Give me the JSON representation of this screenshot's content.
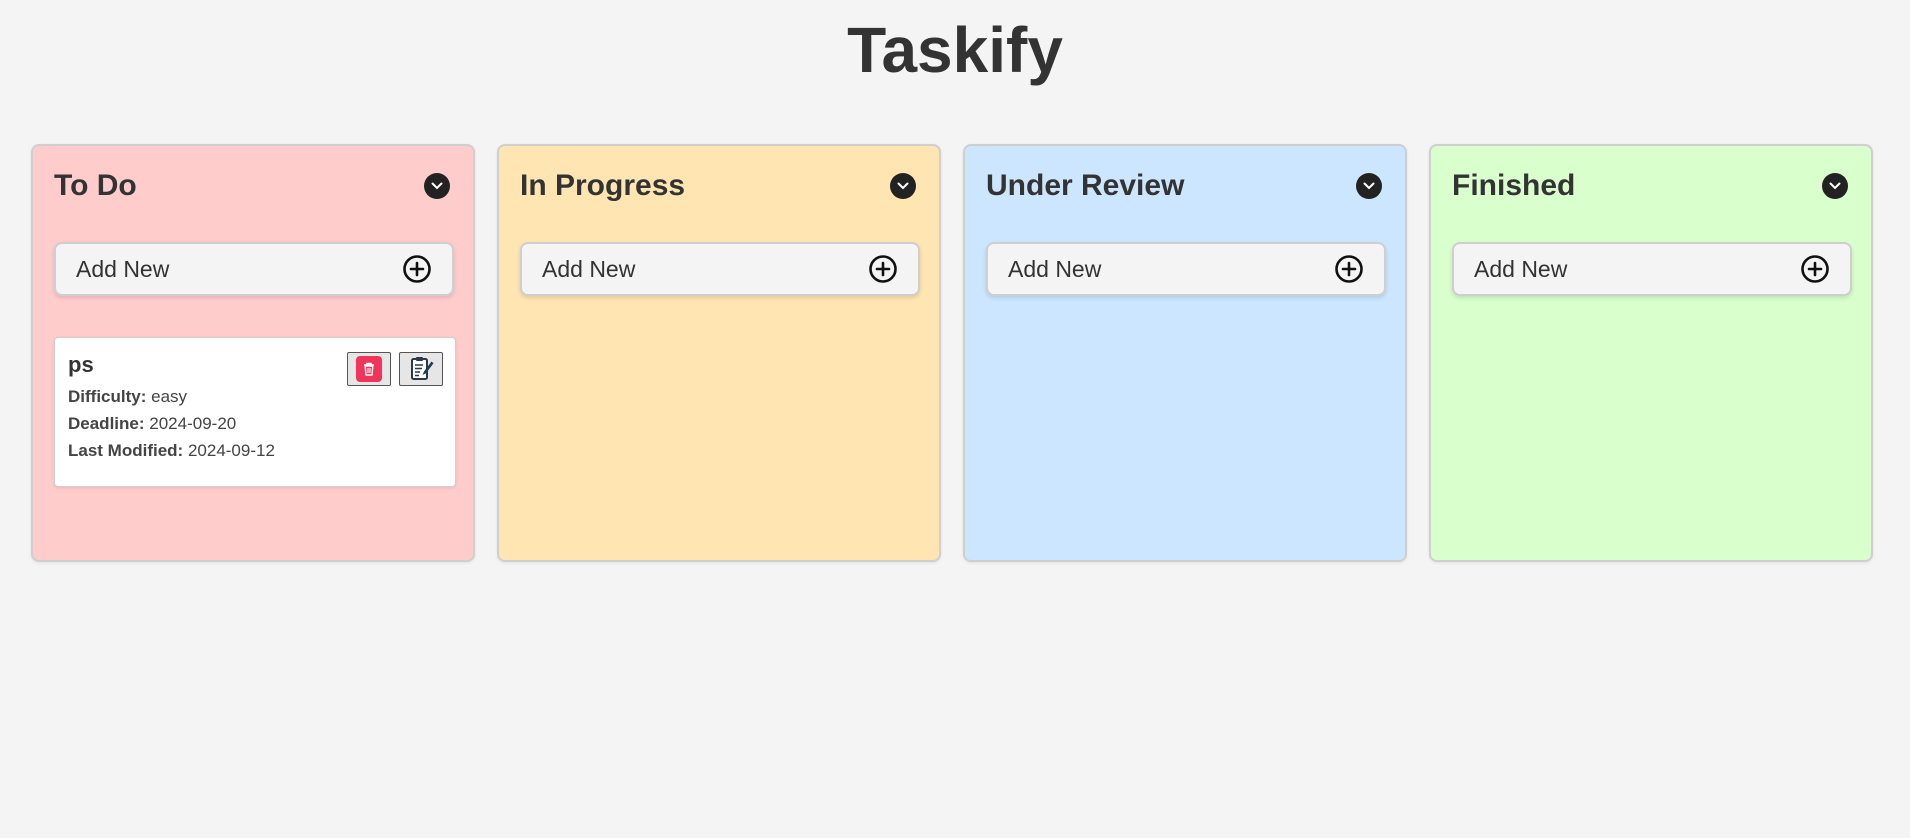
{
  "app": {
    "title": "Taskify"
  },
  "colors": {
    "page_bg": "#f4f4f4",
    "todo_bg": "#ffcccc",
    "in_progress_bg": "#ffe5b1",
    "under_review_bg": "#cce6ff",
    "finished_bg": "#d9ffcc",
    "delete_red": "#f0345a"
  },
  "columns": [
    {
      "title": "To Do",
      "add_label": "Add New",
      "icons": [
        "chevron-down-icon",
        "plus-circle-icon"
      ]
    },
    {
      "title": "In Progress",
      "add_label": "Add New",
      "icons": [
        "chevron-down-icon",
        "plus-circle-icon"
      ]
    },
    {
      "title": "Under Review",
      "add_label": "Add New",
      "icons": [
        "chevron-down-icon",
        "plus-circle-icon"
      ]
    },
    {
      "title": "Finished",
      "add_label": "Add New",
      "icons": [
        "chevron-down-icon",
        "plus-circle-icon"
      ]
    }
  ],
  "tasks": [
    {
      "column": "To Do",
      "title": "ps",
      "difficulty_label": "Difficulty:",
      "difficulty": "easy",
      "deadline_label": "Deadline:",
      "deadline": "2024-09-20",
      "modified_label": "Last Modified:",
      "modified": "2024-09-12",
      "icons": [
        "trash-icon",
        "edit-notes-icon"
      ]
    }
  ]
}
